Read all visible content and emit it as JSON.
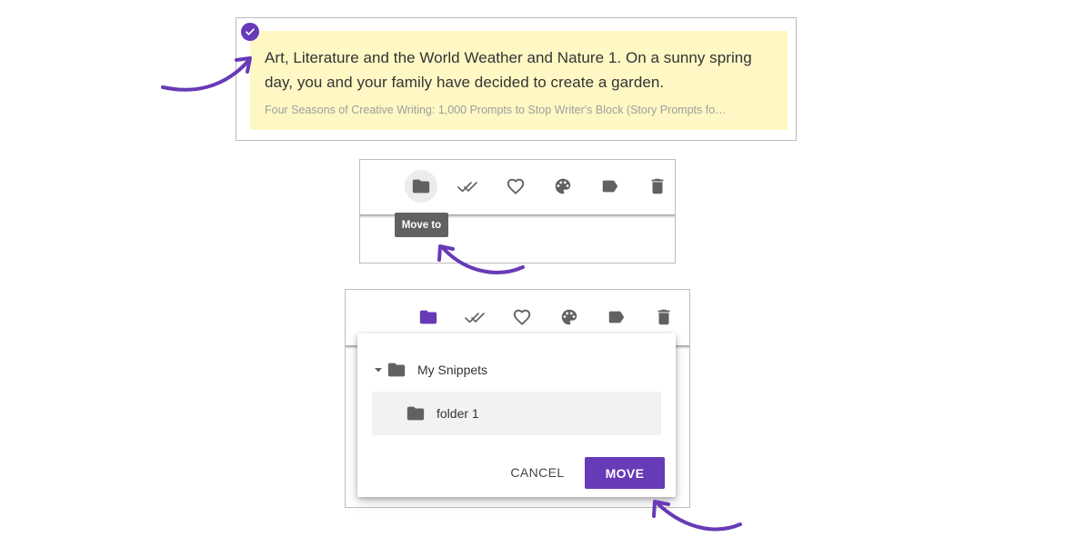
{
  "colors": {
    "accent": "#673ab7",
    "snippet_background": "#fff8c4",
    "icon_gray": "#616161",
    "tooltip_background": "#616161",
    "selected_row_background": "#f2f2f2"
  },
  "snippet": {
    "text": "Art, Literature and the World Weather and Nature 1. On a sunny spring day, you and your family have decided to create a garden.",
    "source": "Four Seasons of Creative Writing: 1,000 Prompts to Stop Writer's Block (Story Prompts fo…",
    "selected": true
  },
  "toolbar": {
    "icons": [
      "folder-icon",
      "done-all-icon",
      "heart-icon",
      "palette-icon",
      "label-icon",
      "trash-icon"
    ]
  },
  "tooltip": {
    "label": "Move to"
  },
  "move_dialog": {
    "root_folder": "My Snippets",
    "child_folder": "folder 1",
    "cancel_label": "CANCEL",
    "move_label": "MOVE"
  }
}
